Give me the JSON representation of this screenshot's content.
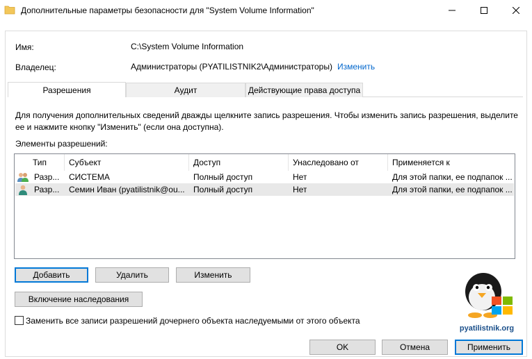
{
  "window": {
    "title": "Дополнительные параметры безопасности  для \"System Volume Information\""
  },
  "header": {
    "name_label": "Имя:",
    "name_value": "C:\\System Volume Information",
    "owner_label": "Владелец:",
    "owner_value": "Администраторы (PYATILISTNIK2\\Администраторы)",
    "owner_change": "Изменить"
  },
  "tabs": [
    {
      "label": "Разрешения",
      "active": true
    },
    {
      "label": "Аудит",
      "active": false
    },
    {
      "label": "Действующие права доступа",
      "active": false
    }
  ],
  "panel": {
    "description": "Для получения дополнительных сведений дважды щелкните запись разрешения. Чтобы изменить запись разрешения, выделите ее и нажмите кнопку \"Изменить\" (если она доступна).",
    "list_label": "Элементы разрешений:"
  },
  "table": {
    "columns": [
      "Тип",
      "Субъект",
      "Доступ",
      "Унаследовано от",
      "Применяется к"
    ],
    "rows": [
      {
        "icon": "users-group-icon",
        "type": "Разр...",
        "subject": "СИСТЕМА",
        "access": "Полный доступ",
        "inherited": "Нет",
        "applies": "Для этой папки, ее подпапок ..."
      },
      {
        "icon": "user-icon",
        "type": "Разр...",
        "subject": "Семин Иван (pyatilistnik@ou...",
        "access": "Полный доступ",
        "inherited": "Нет",
        "applies": "Для этой папки, ее подпапок ..."
      }
    ]
  },
  "buttons": {
    "add": "Добавить",
    "remove": "Удалить",
    "edit": "Изменить",
    "inheritance": "Включение наследования",
    "ok": "OK",
    "cancel": "Отмена",
    "apply": "Применить"
  },
  "replace_checkbox": {
    "label": "Заменить все записи разрешений дочернего объекта наследуемыми от этого объекта",
    "checked": false
  },
  "logo": {
    "text": "pyatilistnik.org"
  },
  "colors": {
    "link": "#0066cc",
    "focus_border": "#0078d7",
    "button_bg": "#e1e1e1"
  }
}
